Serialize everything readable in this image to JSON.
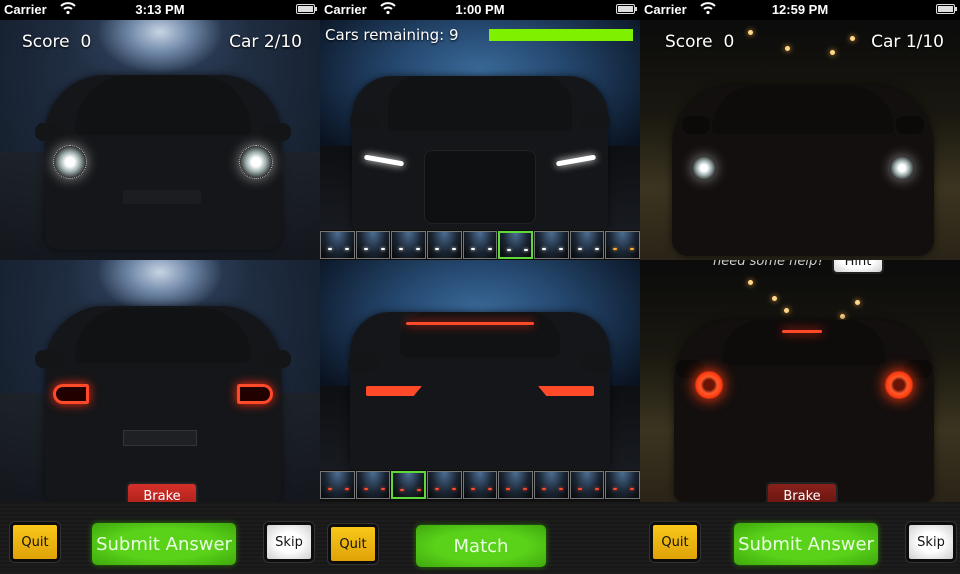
{
  "screens": [
    {
      "status": {
        "carrier": "Carrier",
        "time": "3:13 PM"
      },
      "hud": {
        "score_label": "Score",
        "score_value": "0",
        "car_label": "Car 2/10"
      },
      "buttons": {
        "brake": "Brake",
        "quit": "Quit",
        "submit": "Submit Answer",
        "skip": "Skip"
      }
    },
    {
      "status": {
        "carrier": "Carrier",
        "time": "1:00 PM"
      },
      "hud": {
        "cars_remaining": "Cars remaining: 9",
        "time_progress": 1.0
      },
      "front_thumbnails": {
        "count": 9,
        "selected_index": 5
      },
      "rear_thumbnails": {
        "count": 9,
        "selected_index": 2
      },
      "buttons": {
        "quit": "Quit",
        "match": "Match"
      }
    },
    {
      "status": {
        "carrier": "Carrier",
        "time": "12:59 PM"
      },
      "hud": {
        "score_label": "Score",
        "score_value": "0",
        "car_label": "Car 1/10"
      },
      "help": {
        "text": "need some help?",
        "hint": "Hint"
      },
      "buttons": {
        "brake": "Brake",
        "quit": "Quit",
        "submit": "Submit Answer",
        "skip": "Skip"
      }
    }
  ],
  "colors": {
    "submit_green": "#4cc214",
    "brake_red": "#c22a22",
    "quit_yellow": "#f0b410",
    "progress_green": "#7ff000",
    "selected_thumb": "#5fd93a"
  }
}
